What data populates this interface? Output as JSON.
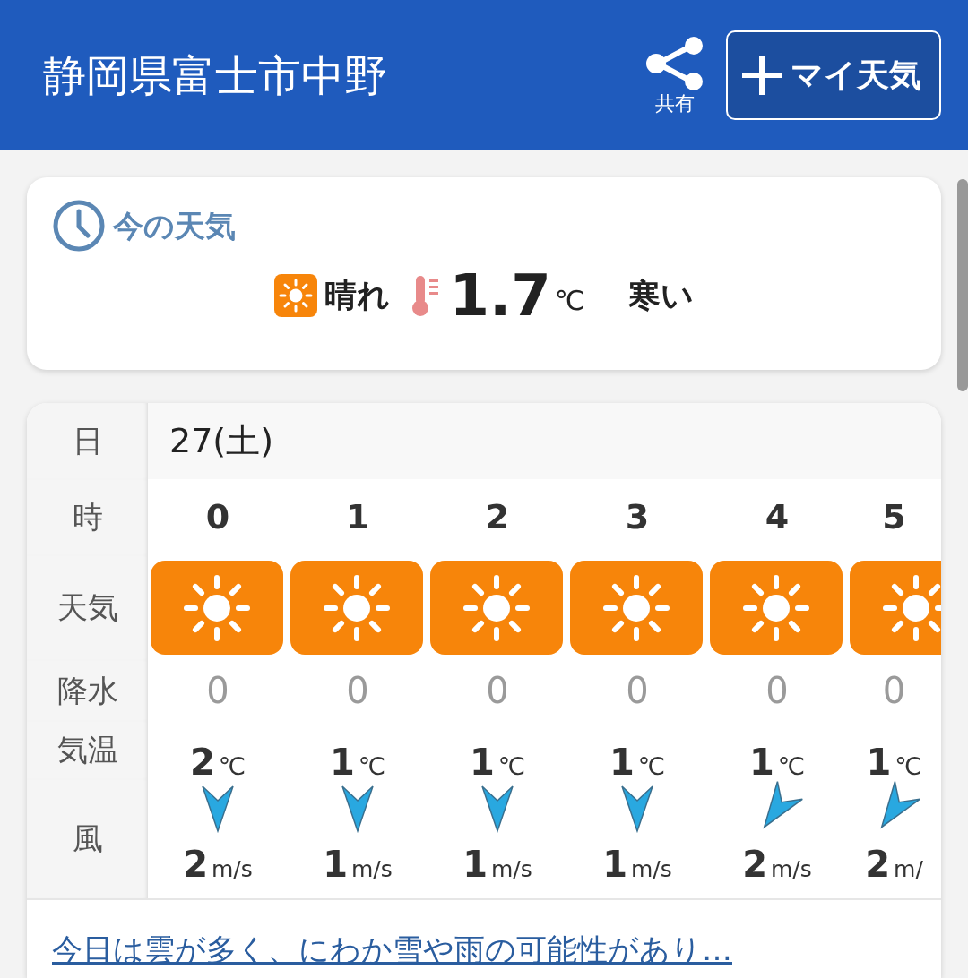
{
  "header": {
    "title": "静岡県富士市中野",
    "share_label": "共有",
    "my_weather_button": "マイ天気"
  },
  "current": {
    "heading": "今の天気",
    "kind": "sunny",
    "condition": "晴れ",
    "temperature": "1.7",
    "temp_unit": "℃",
    "feeling": "寒い"
  },
  "forecast": {
    "row_labels": [
      "日",
      "時",
      "天気",
      "降水",
      "気温",
      "風"
    ],
    "date": "27(土)",
    "hours": [
      {
        "hour": "0",
        "kind": "sunny",
        "precip": "0",
        "temp": "2",
        "temp_unit": "℃",
        "wind": {
          "kind": "north",
          "speed": "2",
          "unit": "m/s"
        }
      },
      {
        "hour": "1",
        "kind": "sunny",
        "precip": "0",
        "temp": "1",
        "temp_unit": "℃",
        "wind": {
          "kind": "north",
          "speed": "1",
          "unit": "m/s"
        }
      },
      {
        "hour": "2",
        "kind": "sunny",
        "precip": "0",
        "temp": "1",
        "temp_unit": "℃",
        "wind": {
          "kind": "north",
          "speed": "1",
          "unit": "m/s"
        }
      },
      {
        "hour": "3",
        "kind": "sunny",
        "precip": "0",
        "temp": "1",
        "temp_unit": "℃",
        "wind": {
          "kind": "north",
          "speed": "1",
          "unit": "m/s"
        }
      },
      {
        "hour": "4",
        "kind": "sunny",
        "precip": "0",
        "temp": "1",
        "temp_unit": "℃",
        "wind": {
          "kind": "northeast",
          "speed": "2",
          "unit": "m/s"
        }
      },
      {
        "hour": "5",
        "kind": "sunny",
        "precip": "0",
        "temp": "1",
        "temp_unit": "℃",
        "wind": {
          "kind": "northeast",
          "speed": "2",
          "unit": "m/"
        }
      }
    ]
  },
  "summary_link": "今日は雲が多く、にわか雪や雨の可能性があり…"
}
